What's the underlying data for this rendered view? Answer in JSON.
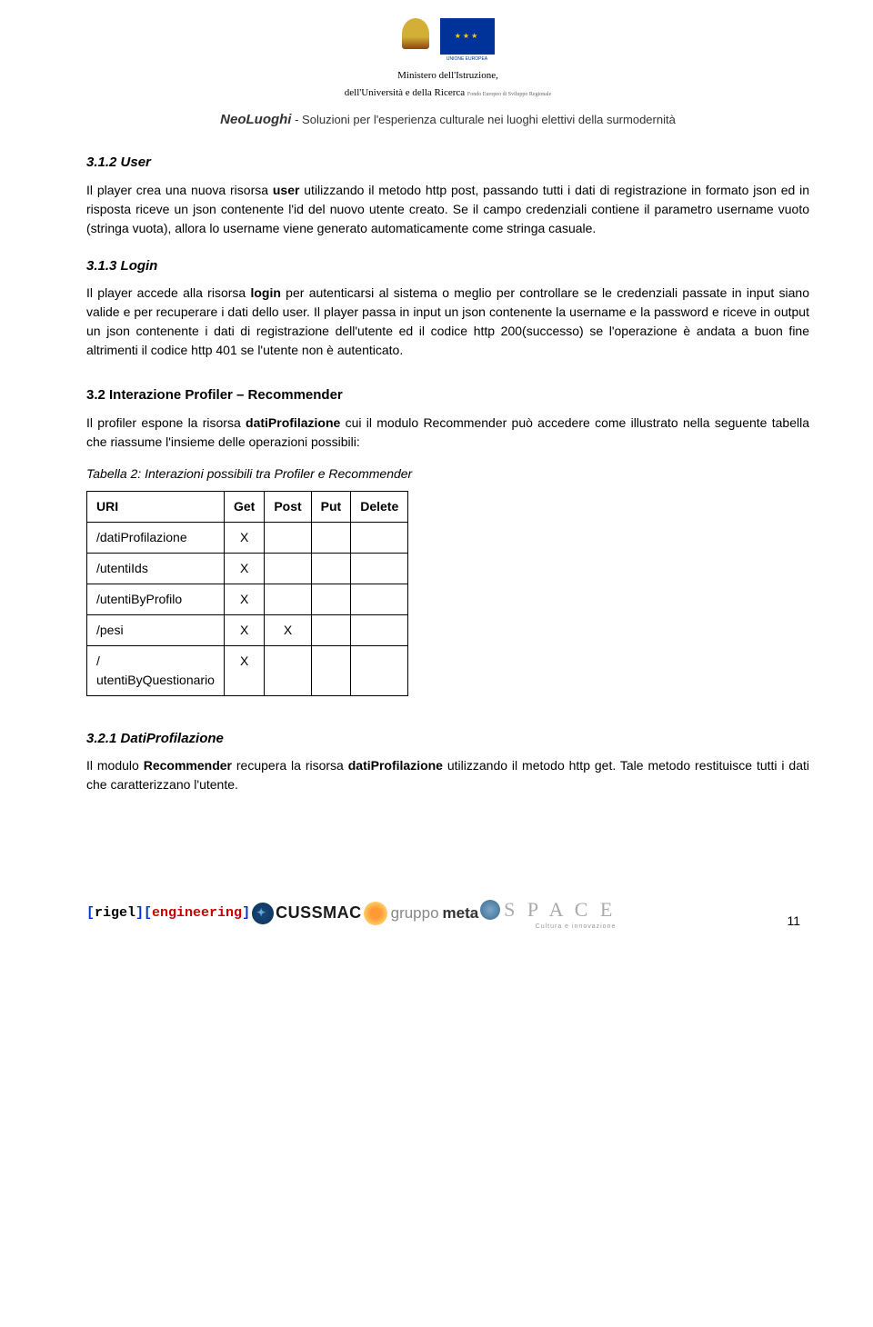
{
  "header": {
    "ministero_line1": "Ministero dell'Istruzione,",
    "ministero_line2": "dell'Università e della Ricerca",
    "fondo_line1": "UNIONE EUROPEA",
    "fondo_line2": "Fondo Europeo di Sviluppo Regionale",
    "brand": "NeoLuoghi",
    "dash": " - ",
    "tagline": "Soluzioni per l'esperienza culturale nei luoghi elettivi della surmodernità"
  },
  "section_user": {
    "heading": "3.1.2 User",
    "para": "Il player crea una nuova risorsa <b>user</b> utilizzando il metodo http post, passando tutti i dati di registrazione in formato json ed in risposta riceve un json contenente l'id del nuovo utente creato. Se il campo credenziali contiene il parametro username vuoto (stringa vuota), allora lo username viene generato automaticamente come stringa casuale."
  },
  "section_login": {
    "heading": "3.1.3 Login",
    "para": "Il player accede alla risorsa <b>login</b> per autenticarsi al sistema o meglio per controllare se le credenziali passate in input siano valide e per recuperare i dati dello user. Il player passa in input un json contenente la username e la password e riceve in output un json contenente i dati di registrazione dell'utente ed il codice http 200(successo) se l'operazione è andata a buon fine altrimenti il codice http 401 se l'utente non è autenticato."
  },
  "section_interaction": {
    "heading": "3.2   Interazione Profiler – Recommender",
    "para": "Il profiler espone la risorsa <b>datiProfilazione</b> cui il  modulo Recommender può accedere come illustrato nella seguente tabella che riassume l'insieme delle operazioni possibili:",
    "table_caption": "Tabella 2: Interazioni possibili tra Profiler e Recommender",
    "table": {
      "headers": [
        "URI",
        "Get",
        "Post",
        "Put",
        "Delete"
      ],
      "rows": [
        {
          "uri": "/datiProfilazione",
          "get": "X",
          "post": "",
          "put": "",
          "delete": ""
        },
        {
          "uri": "/utentiIds",
          "get": "X",
          "post": "",
          "put": "",
          "delete": ""
        },
        {
          "uri": "/utentiByProfilo",
          "get": "X",
          "post": "",
          "put": "",
          "delete": ""
        },
        {
          "uri": "/pesi",
          "get": "X",
          "post": "X",
          "put": "",
          "delete": ""
        },
        {
          "uri": "/\nutentiByQuestionario",
          "get": "X",
          "post": "",
          "put": "",
          "delete": ""
        }
      ]
    }
  },
  "section_dati": {
    "heading": "3.2.1 DatiProfilazione",
    "para": "Il modulo <b>Recommender</b> recupera la risorsa <b>datiProfilazione</b> utilizzando il metodo http get. Tale metodo restituisce tutti i dati che caratterizzano l'utente."
  },
  "footer": {
    "rigel": "[rigel][engineering]",
    "cussmac": "CUSSMAC",
    "gruppo": "gruppo",
    "meta": "meta",
    "space": "S P A C E",
    "space_sub": "Cultura e innovazione",
    "page": "11"
  }
}
